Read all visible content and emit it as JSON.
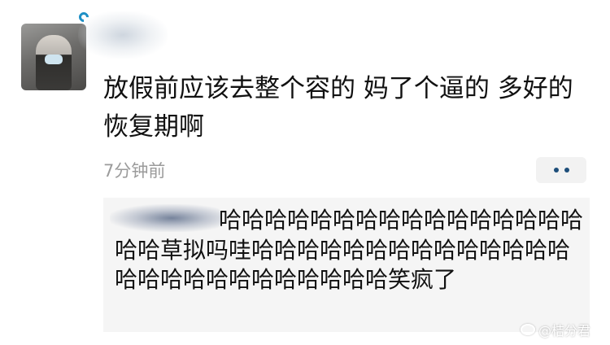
{
  "post": {
    "text": "放假前应该去整个容的 妈了个逼的 多好的恢复期啊",
    "timestamp": "7分钟前"
  },
  "reply": {
    "text": "哈哈哈哈哈哈哈哈哈哈哈哈哈哈哈哈哈哈草拟吗哇哈哈哈哈哈哈哈哈哈哈哈哈哈哈哈哈哈哈哈哈哈哈哈哈哈哈笑疯了"
  },
  "watermark": {
    "text": "@桔分君"
  },
  "icons": {
    "more": "more-dots-icon",
    "vip": "vip-badge-icon",
    "weibo": "weibo-logo-icon"
  },
  "colors": {
    "timestamp": "#9b9b9b",
    "reply_background": "#f5f5f5",
    "more_dots": "#1d4e7a",
    "vip_badge": "#1e90c6"
  }
}
